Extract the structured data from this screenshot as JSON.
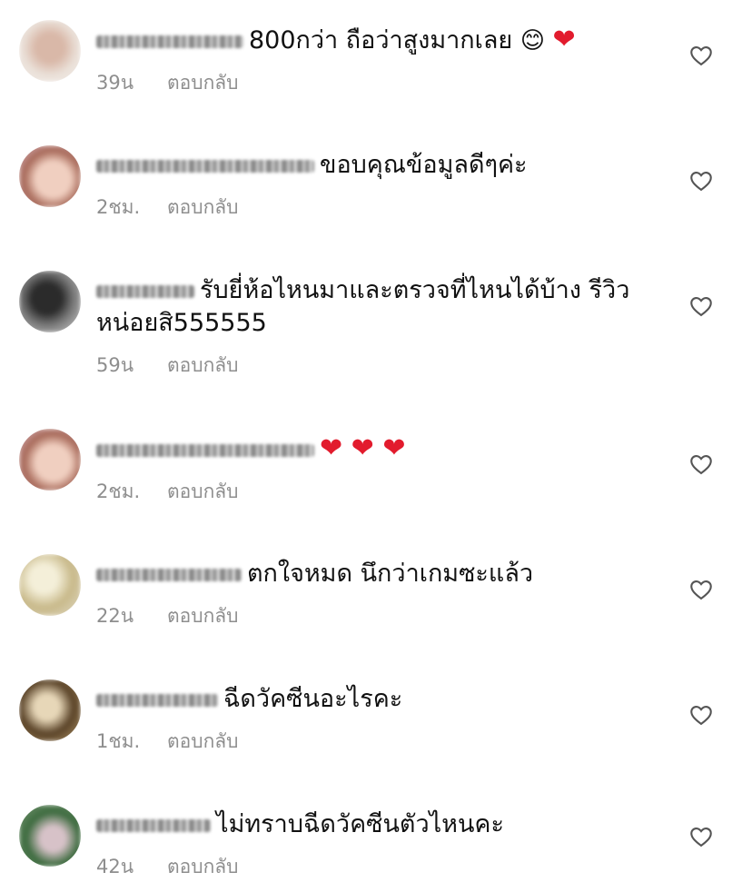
{
  "comments": [
    {
      "time": "39น",
      "reply": "ตอบกลับ",
      "text": "800กว่า ถือว่าสูงมากเลย",
      "emoji": "😊",
      "hearts": "❤"
    },
    {
      "time": "2ชม.",
      "reply": "ตอบกลับ",
      "text": "ขอบคุณข้อมูลดีๆค่ะ"
    },
    {
      "time": "59น",
      "reply": "ตอบกลับ",
      "text": "รับยี่ห้อไหนมาและตรวจที่ไหนได้บ้าง รีวิว",
      "text2": "หน่อยสิ555555"
    },
    {
      "time": "2ชม.",
      "reply": "ตอบกลับ",
      "hearts": "❤ ❤ ❤"
    },
    {
      "time": "22น",
      "reply": "ตอบกลับ",
      "text": "ตกใจหมด นึกว่าเกมซะแล้ว"
    },
    {
      "time": "1ชม.",
      "reply": "ตอบกลับ",
      "text": "ฉีดวัคซีนอะไรคะ"
    },
    {
      "time": "42น",
      "reply": "ตอบกลับ",
      "text": "ไม่ทราบฉีดวัคซีนตัวไหนคะ"
    }
  ],
  "icons": {
    "like": "heart-outline-icon"
  },
  "colors": {
    "meta": "#8e8e8e",
    "text": "#111111",
    "heart": "#e21b2d"
  }
}
